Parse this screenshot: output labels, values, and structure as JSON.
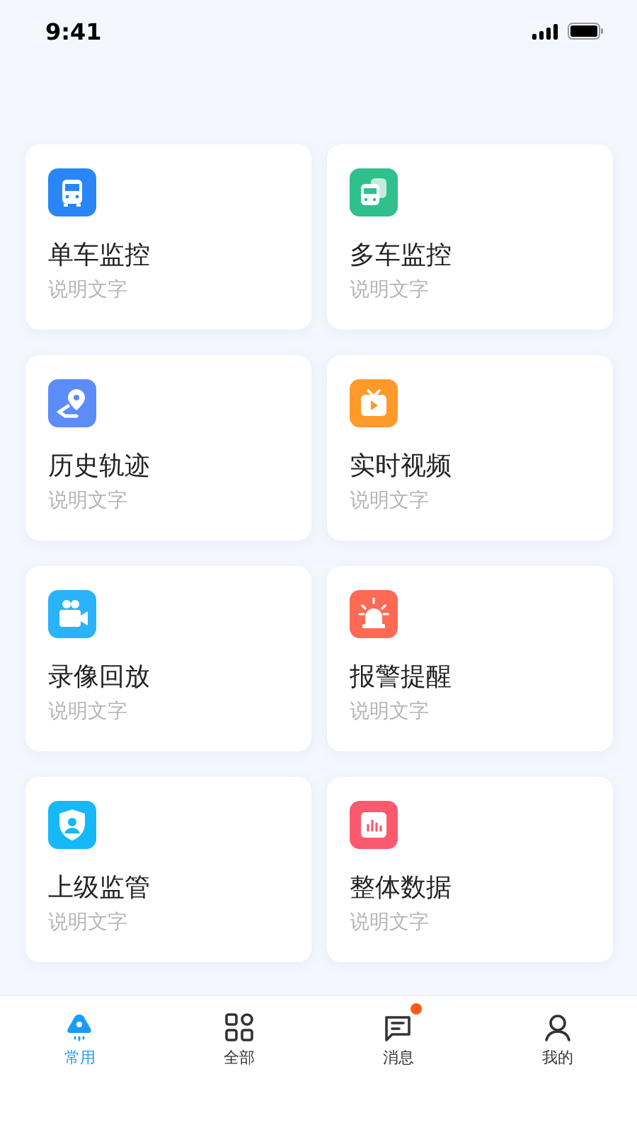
{
  "status_bar": {
    "time": "9:41"
  },
  "cards": [
    {
      "title": "单车监控",
      "subtitle": "说明文字",
      "color": "#2a86f7"
    },
    {
      "title": "多车监控",
      "subtitle": "说明文字",
      "color": "#2fc08c"
    },
    {
      "title": "历史轨迹",
      "subtitle": "说明文字",
      "color": "#5b8cf7"
    },
    {
      "title": "实时视频",
      "subtitle": "说明文字",
      "color": "#ff9a2a"
    },
    {
      "title": "录像回放",
      "subtitle": "说明文字",
      "color": "#2ab2fb"
    },
    {
      "title": "报警提醒",
      "subtitle": "说明文字",
      "color": "#ff6a55"
    },
    {
      "title": "上级监管",
      "subtitle": "说明文字",
      "color": "#16b8f8"
    },
    {
      "title": "整体数据",
      "subtitle": "说明文字",
      "color": "#fb5a6e"
    }
  ],
  "tab_bar": [
    {
      "label": "常用",
      "selected": true,
      "badge": false
    },
    {
      "label": "全部",
      "selected": false,
      "badge": false
    },
    {
      "label": "消息",
      "selected": false,
      "badge": true
    },
    {
      "label": "我的",
      "selected": false,
      "badge": false
    }
  ]
}
